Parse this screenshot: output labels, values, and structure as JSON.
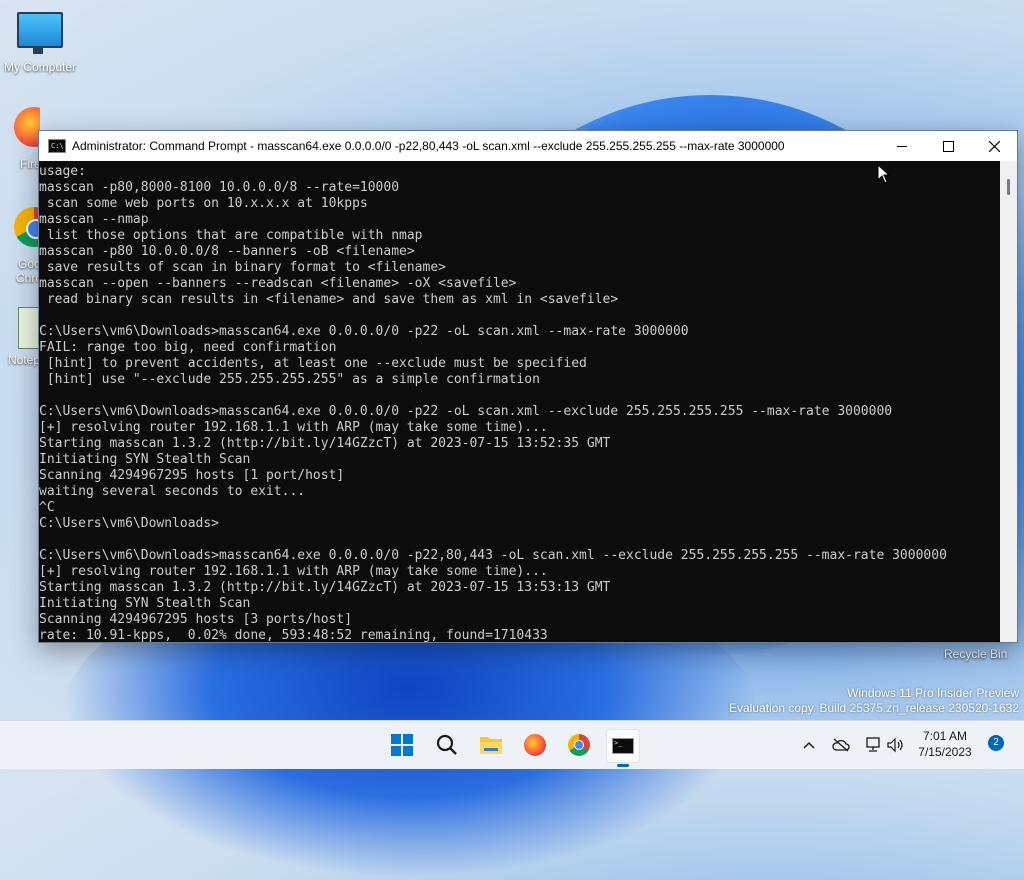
{
  "desktop": {
    "icons": [
      {
        "label": "My Computer",
        "icon": "monitor-icon"
      },
      {
        "label": "Fire",
        "icon": "firefox-icon"
      },
      {
        "label": "Goo",
        "label2": "Chro",
        "icon": "chrome-icon"
      },
      {
        "label": "Notep",
        "icon": "notepad-icon"
      }
    ],
    "recycle_bin": "Recycle Bin",
    "watermark": {
      "line1": "Windows 11 Pro Insider Preview",
      "line2": "Evaluation copy. Build 25375.zn_release.230520-1632"
    }
  },
  "window": {
    "title": "Administrator:  Command Prompt - masscan64.exe  0.0.0.0/0 -p22,80,443 -oL scan.xml --exclude 255.255.255.255 --max-rate 3000000",
    "icon_text": "C:\\",
    "console_lines": [
      "usage:",
      "masscan -p80,8000-8100 10.0.0.0/8 --rate=10000",
      " scan some web ports on 10.x.x.x at 10kpps",
      "masscan --nmap",
      " list those options that are compatible with nmap",
      "masscan -p80 10.0.0.0/8 --banners -oB <filename>",
      " save results of scan in binary format to <filename>",
      "masscan --open --banners --readscan <filename> -oX <savefile>",
      " read binary scan results in <filename> and save them as xml in <savefile>",
      "",
      "C:\\Users\\vm6\\Downloads>masscan64.exe 0.0.0.0/0 -p22 -oL scan.xml --max-rate 3000000",
      "FAIL: range too big, need confirmation",
      " [hint] to prevent accidents, at least one --exclude must be specified",
      " [hint] use \"--exclude 255.255.255.255\" as a simple confirmation",
      "",
      "C:\\Users\\vm6\\Downloads>masscan64.exe 0.0.0.0/0 -p22 -oL scan.xml --exclude 255.255.255.255 --max-rate 3000000",
      "[+] resolving router 192.168.1.1 with ARP (may take some time)...",
      "Starting masscan 1.3.2 (http://bit.ly/14GZzcT) at 2023-07-15 13:52:35 GMT",
      "Initiating SYN Stealth Scan",
      "Scanning 4294967295 hosts [1 port/host]",
      "waiting several seconds to exit...",
      "^C",
      "C:\\Users\\vm6\\Downloads>",
      "",
      "C:\\Users\\vm6\\Downloads>masscan64.exe 0.0.0.0/0 -p22,80,443 -oL scan.xml --exclude 255.255.255.255 --max-rate 3000000",
      "[+] resolving router 192.168.1.1 with ARP (may take some time)...",
      "Starting masscan 1.3.2 (http://bit.ly/14GZzcT) at 2023-07-15 13:53:13 GMT",
      "Initiating SYN Stealth Scan",
      "Scanning 4294967295 hosts [3 ports/host]",
      "rate: 10.91-kpps,  0.02% done, 593:48:52 remaining, found=1710433"
    ],
    "controls": {
      "minimize": "minimize-icon",
      "maximize": "maximize-icon",
      "close": "close-icon"
    }
  },
  "taskbar": {
    "apps": [
      "start-icon",
      "search-icon",
      "file-explorer-icon",
      "firefox-icon",
      "chrome-icon",
      "command-prompt-icon"
    ],
    "tray": [
      "chevron-up-icon",
      "onedrive-offline-icon",
      "network-icon",
      "volume-icon"
    ],
    "clock": {
      "time": "7:01 AM",
      "date": "7/15/2023"
    },
    "notification_count": "2"
  },
  "colors": {
    "console_bg": "#0c0c0c",
    "console_fg": "#cccccc",
    "accent": "#0067c0"
  }
}
